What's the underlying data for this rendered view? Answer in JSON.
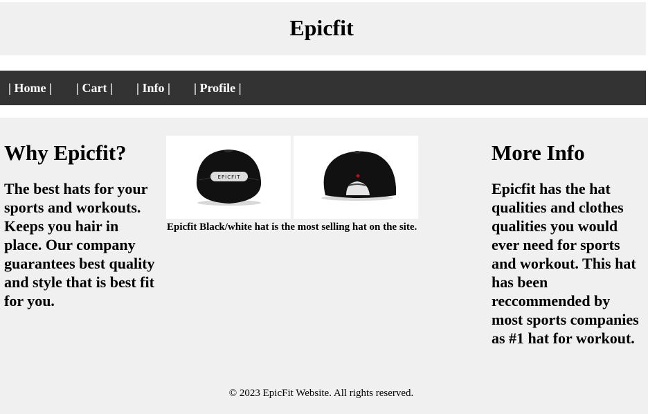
{
  "header": {
    "title": "Epicfit"
  },
  "nav": {
    "items": [
      {
        "label": "| Home |"
      },
      {
        "label": "| Cart |"
      },
      {
        "label": "| Info |"
      },
      {
        "label": "| Profile |"
      }
    ]
  },
  "left": {
    "heading": "Why Epicfit?",
    "text": "The best hats for your sports and workouts. Keeps you hair in place. Our company guarantees best quality and style that is best fit for you."
  },
  "gallery": {
    "images": [
      {
        "alt": "Black/white hat front",
        "logo_text": "EPICFIT"
      },
      {
        "alt": "Black hat back"
      }
    ],
    "caption": "Epicfit Black/white hat is the most selling hat on the site."
  },
  "right": {
    "heading": "More Info",
    "text": "Epicfit has the hat qualities and clothes qualities you would ever need for sports and workout. This hat has been reccommended by most sports companies as #1 hat for workout."
  },
  "footer": {
    "text": "© 2023 EpicFit Website. All rights reserved."
  }
}
